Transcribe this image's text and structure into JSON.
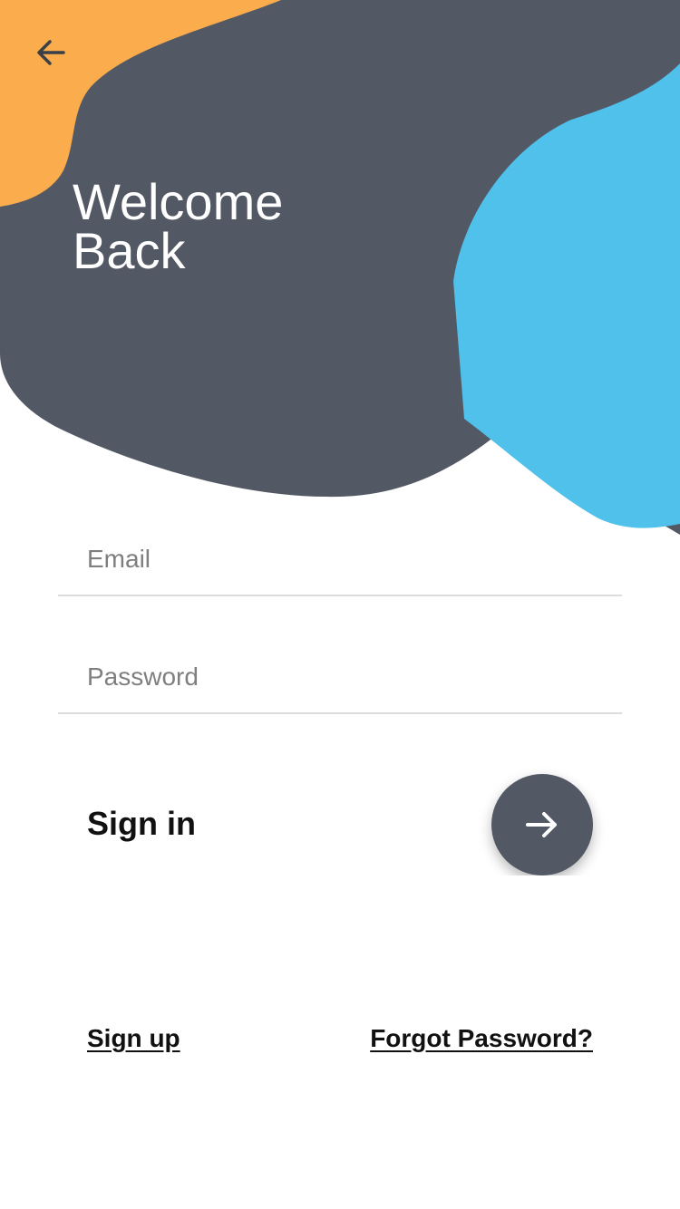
{
  "header": {
    "title": "Welcome\nBack",
    "back_icon": "arrow-left-icon"
  },
  "form": {
    "email": {
      "placeholder": "Email",
      "value": ""
    },
    "password": {
      "placeholder": "Password",
      "value": ""
    }
  },
  "sign_in": {
    "label": "Sign in",
    "button_icon": "arrow-right-icon"
  },
  "links": {
    "sign_up": "Sign up",
    "forgot_password": "Forgot Password?"
  },
  "colors": {
    "dark_blob": "#535865",
    "orange_blob": "#FBAC4C",
    "blue_blob": "#4FC1EA",
    "background": "#FFFFFF"
  }
}
